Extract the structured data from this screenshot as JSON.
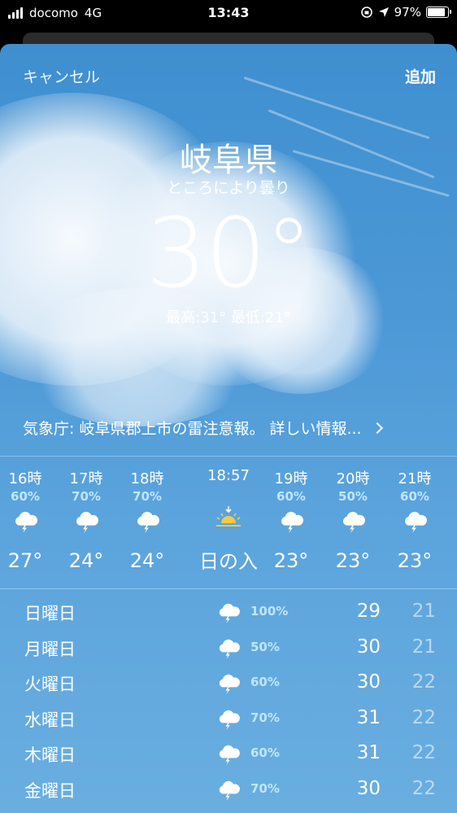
{
  "status_bar": {
    "carrier": "docomo",
    "network": "4G",
    "time": "13:43",
    "battery": "97%",
    "battery_level": 0.97
  },
  "header": {
    "cancel_label": "キャンセル",
    "add_label": "追加"
  },
  "current": {
    "city": "岐阜県",
    "condition": "ところにより曇り",
    "temperature": "30°",
    "hilo": "最高:31° 最低:21°"
  },
  "alert": {
    "text": "気象庁: 岐阜県郡上市の雷注意報。 詳しい情報..."
  },
  "hourly": [
    {
      "time": "16時",
      "pct": "60%",
      "icon": "thunderstorm-icon",
      "temp": "27°"
    },
    {
      "time": "17時",
      "pct": "70%",
      "icon": "thunderstorm-icon",
      "temp": "24°"
    },
    {
      "time": "18時",
      "pct": "70%",
      "icon": "thunderstorm-icon",
      "temp": "24°"
    },
    {
      "time": "18:57",
      "pct": "",
      "icon": "sunset-icon",
      "temp": "日の入"
    },
    {
      "time": "19時",
      "pct": "60%",
      "icon": "thunderstorm-icon",
      "temp": "23°"
    },
    {
      "time": "20時",
      "pct": "50%",
      "icon": "thunderstorm-icon",
      "temp": "23°"
    },
    {
      "time": "21時",
      "pct": "60%",
      "icon": "thunderstorm-icon",
      "temp": "23°"
    }
  ],
  "daily": [
    {
      "day": "日曜日",
      "pct": "100%",
      "high": "29",
      "low": "21"
    },
    {
      "day": "月曜日",
      "pct": "50%",
      "high": "30",
      "low": "21"
    },
    {
      "day": "火曜日",
      "pct": "60%",
      "high": "30",
      "low": "22"
    },
    {
      "day": "水曜日",
      "pct": "70%",
      "high": "31",
      "low": "22"
    },
    {
      "day": "木曜日",
      "pct": "60%",
      "high": "31",
      "low": "22"
    },
    {
      "day": "金曜日",
      "pct": "70%",
      "high": "30",
      "low": "22"
    }
  ],
  "colors": {
    "sky_top": "#3f8fd0",
    "sky_bottom": "#6aaee0",
    "precip": "#bfe6ff",
    "sun": "#f6c945"
  }
}
